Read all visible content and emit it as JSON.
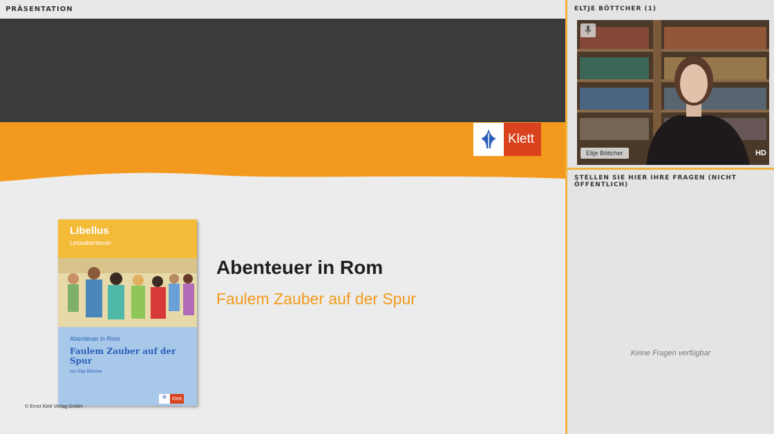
{
  "presentation": {
    "panel_title": "PRÄSENTATION",
    "slide": {
      "brand": "Klett",
      "title": "Abenteuer in Rom",
      "subtitle": "Faulem Zauber auf der Spur",
      "copyright": "© Ernst Klett Verlag GmbH",
      "book": {
        "series": "Libellus",
        "series_sub": "Leseabenteuer",
        "title_small": "Abenteuer in Rom",
        "title_main": "Faulem Zauber auf der Spur",
        "author": "von Eltje Böttcher",
        "brand": "Klett"
      }
    }
  },
  "speaker": {
    "panel_title": "ELTJE BÖTTCHER (1)",
    "name_tag": "Eltje Böttcher",
    "quality_badge": "HD"
  },
  "questions": {
    "panel_title": "STELLEN SIE HIER IHRE FRAGEN (NICHT ÖFFENTLICH)",
    "empty_text": "Keine Fragen verfügbar"
  },
  "colors": {
    "accent": "#f0b43c",
    "slide_orange": "#f29a1c",
    "klett_red": "#d9421d"
  },
  "icons": [
    "microphone-icon",
    "klett-logo-icon"
  ]
}
